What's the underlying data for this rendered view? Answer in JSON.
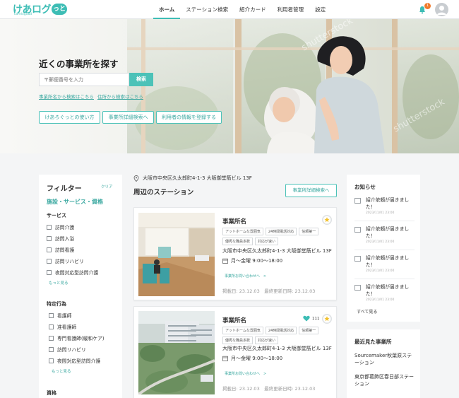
{
  "brand": {
    "name": "けあログ",
    "mark": "っと",
    "sub": "careloguud"
  },
  "nav": {
    "items": [
      {
        "label": "ホーム",
        "active": true
      },
      {
        "label": "ステーション検索",
        "active": false
      },
      {
        "label": "紹介カード",
        "active": false
      },
      {
        "label": "利用者管理",
        "active": false
      },
      {
        "label": "設定",
        "active": false
      }
    ],
    "notification_count": "1"
  },
  "hero": {
    "title": "近くの事業所を探す",
    "search_placeholder": "〒郵便番号を入力",
    "search_button": "検索",
    "link_name_search": "事業所名から検索はこちら",
    "link_address_search": "住所から検索はこちら",
    "buttons": [
      "けあろぐっとの使い方",
      "事業所詳細検索へ",
      "利用者の情報を登録する"
    ]
  },
  "filter": {
    "title": "フィルター",
    "clear": "クリア",
    "subtitle": "施設・サービス・資格",
    "services_heading": "サービス",
    "services": [
      "訪問介護",
      "訪問入浴",
      "訪問看護",
      "訪問リハビリ",
      "夜間対応型訪問介護"
    ],
    "more_label": "もっと見る",
    "specific_heading": "特定行為",
    "specific": [
      "看護師",
      "准看護師",
      "専門看護師(緩和ケア)",
      "訪問リハビリ",
      "夜間対応型訪問介護"
    ],
    "qualification_heading": "資格"
  },
  "main": {
    "location": "大阪市中央区久太郎町4-1-3 大阪御堂筋ビル 13F",
    "title": "周辺のステーション",
    "detail_search_button": "事業所詳細検索へ",
    "cards": [
      {
        "name": "事業所名",
        "tags": [
          "アットホームな雰囲気",
          "24時間電話対応",
          "信頼第一",
          "優秀な職員多数",
          "対応が速い"
        ],
        "address": "大阪市中央区久太郎町4-1-3 大阪御堂筋ビル 13F",
        "hours": "月〜金曜 9:00〜18:00",
        "contact": "事業所お問い合わせへ　>",
        "dates": "掲載日: 23.12.03　最終更新日時: 23.12.03",
        "likes": ""
      },
      {
        "name": "事業所名",
        "tags": [
          "アットホームな雰囲気",
          "24時間電話対応",
          "信頼第一",
          "優秀な職員多数",
          "対応が速い"
        ],
        "address": "大阪市中央区久太郎町4-1-3 大阪御堂筋ビル 13F",
        "hours": "月〜金曜 9:00〜18:00",
        "contact": "事業所お問い合わせへ　>",
        "dates": "掲載日: 23.12.03　最終更新日時: 23.12.03",
        "likes": "111"
      }
    ]
  },
  "news": {
    "title": "お知らせ",
    "items": [
      {
        "text": "紹介依頼が届きました！",
        "date": "2023/11/01 23:00"
      },
      {
        "text": "紹介依頼が届きました！",
        "date": "2023/11/01 23:00"
      },
      {
        "text": "紹介依頼が届きました！",
        "date": "2023/11/01 23:00"
      },
      {
        "text": "紹介依頼が届きました！",
        "date": "2023/11/01 23:00"
      }
    ],
    "see_all": "すべて見る"
  },
  "recent": {
    "title": "最近見た事業所",
    "items": [
      "Sourcemaker秋葉原ステーション",
      "東京都葛飾区春日部ステーション"
    ]
  },
  "colors": {
    "accent": "#4cc2b8",
    "accent_text": "#3aa8a0",
    "badge": "#f07a2b",
    "star": "#f2c230",
    "heart": "#3dbdb5"
  }
}
